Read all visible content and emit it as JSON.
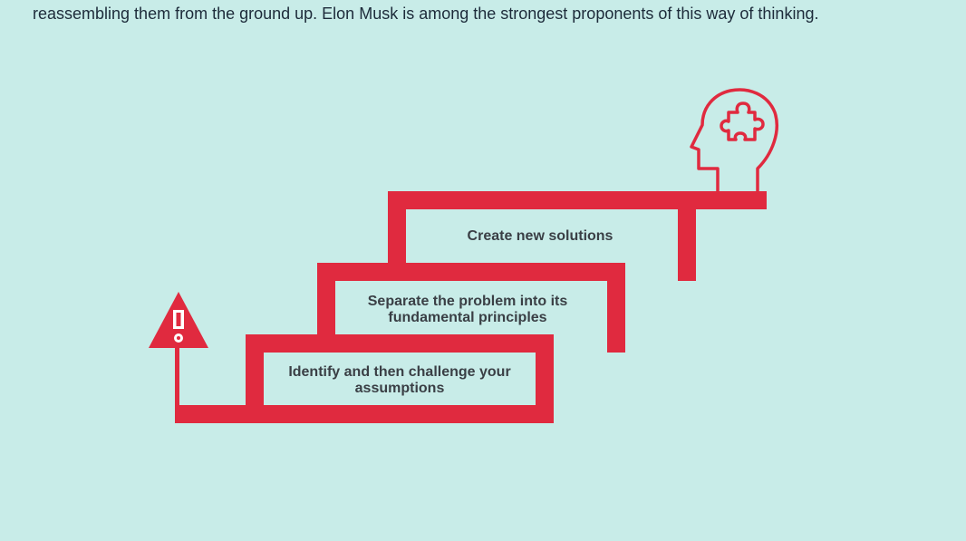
{
  "article": {
    "intro_text": "reassembling them from the ground up. Elon Musk is among the strongest proponents of this way of thinking."
  },
  "diagram": {
    "colors": {
      "background": "#c8ece8",
      "accent": "#e02a3f",
      "text": "#3a3f45",
      "box_fill": "#c8ece8"
    },
    "start_icon": "warning-triangle-icon",
    "end_icon": "head-with-puzzle-icon",
    "steps": [
      {
        "line1": "Identify and then challenge your",
        "line2": "assumptions"
      },
      {
        "line1": "Separate the problem into its",
        "line2": "fundamental principles"
      },
      {
        "line1": "Create new solutions",
        "line2": ""
      }
    ]
  }
}
